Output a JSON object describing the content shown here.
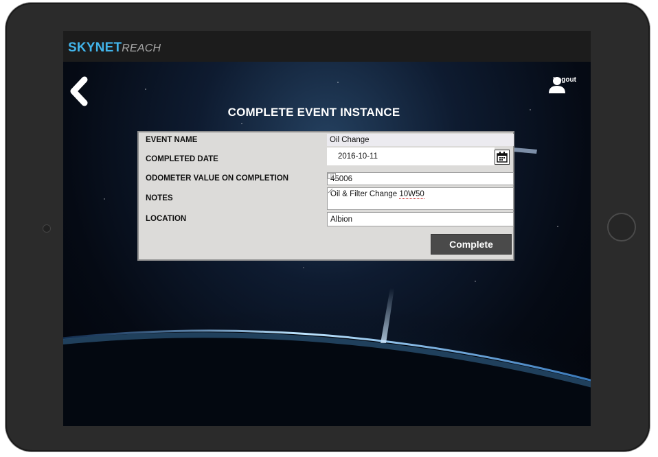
{
  "app": {
    "brand_primary": "SKYNET",
    "brand_secondary": "REACH"
  },
  "header": {
    "logout_label": "Logout"
  },
  "page": {
    "title": "COMPLETE EVENT INSTANCE"
  },
  "form": {
    "event_name": {
      "label": "EVENT NAME",
      "value": "Oil Change"
    },
    "completed_date": {
      "label": "COMPLETED DATE",
      "value": "2016-10-11"
    },
    "odometer": {
      "label": "ODOMETER VALUE ON COMPLETION",
      "value": "45006"
    },
    "notes": {
      "label": "NOTES",
      "value_pre": "Oil & Filter Change ",
      "value_word": "10W50"
    },
    "location": {
      "label": "LOCATION",
      "value": "Albion"
    },
    "submit_label": "Complete"
  },
  "icons": {
    "back": "chevron-left-icon",
    "logout": "user-icon",
    "date": "calendar-icon",
    "number": "number-spin-icon"
  },
  "colors": {
    "brand_accent": "#42b4ea",
    "button": "#4a4a4a",
    "form_bg": "#dcdbd9"
  }
}
